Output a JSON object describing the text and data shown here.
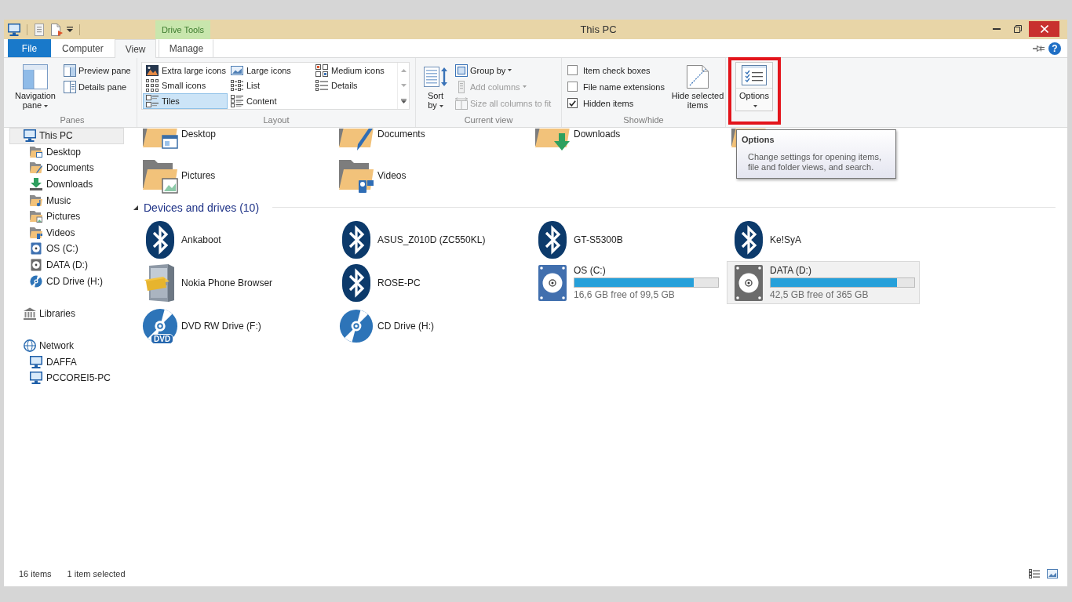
{
  "window": {
    "title": "This PC",
    "context_header": "Drive Tools"
  },
  "tabs": [
    {
      "label": "File",
      "kind": "file",
      "selected": false
    },
    {
      "label": "Computer",
      "kind": "tab",
      "selected": false
    },
    {
      "label": "View",
      "kind": "tab",
      "selected": true
    },
    {
      "label": "Manage",
      "kind": "context",
      "selected": false
    }
  ],
  "help": "?",
  "ribbon": {
    "panes": {
      "label": "Panes",
      "navigation_pane": {
        "label": "Navigation pane",
        "dropdown": true
      },
      "buttons": [
        {
          "label": "Preview pane"
        },
        {
          "label": "Details pane"
        }
      ]
    },
    "layout": {
      "label": "Layout",
      "options": [
        {
          "label": "Extra large icons",
          "selected": false
        },
        {
          "label": "Large icons",
          "selected": false
        },
        {
          "label": "Medium icons",
          "selected": false
        },
        {
          "label": "Small icons",
          "selected": false
        },
        {
          "label": "List",
          "selected": false
        },
        {
          "label": "Details",
          "selected": false
        },
        {
          "label": "Tiles",
          "selected": true
        },
        {
          "label": "Content",
          "selected": false
        }
      ]
    },
    "current_view": {
      "label": "Current view",
      "sort_by": {
        "label": "Sort by",
        "dropdown": true
      },
      "buttons": [
        {
          "label": "Group by",
          "dropdown": true,
          "disabled": false
        },
        {
          "label": "Add columns",
          "dropdown": true,
          "disabled": true
        },
        {
          "label": "Size all columns to fit",
          "dropdown": false,
          "disabled": true
        }
      ]
    },
    "show_hide": {
      "label": "Show/hide",
      "checkboxes": [
        {
          "label": "Item check boxes",
          "checked": false
        },
        {
          "label": "File name extensions",
          "checked": false
        },
        {
          "label": "Hidden items",
          "checked": true
        }
      ],
      "hide_selected": {
        "label": "Hide selected items"
      }
    },
    "options": {
      "label": "Options",
      "dropdown": true,
      "hovered": true,
      "highlighted": true
    }
  },
  "tooltip": {
    "title": "Options",
    "text": "Change settings for opening items, file and folder views, and search."
  },
  "sidebar": {
    "items": [
      {
        "label": "This PC",
        "kind": "pc",
        "selected": true,
        "children": [
          {
            "label": "Desktop",
            "kind": "desktop",
            "selected": false
          },
          {
            "label": "Documents",
            "kind": "documents",
            "selected": false
          },
          {
            "label": "Downloads",
            "kind": "downloads",
            "selected": false
          },
          {
            "label": "Music",
            "kind": "music",
            "selected": false
          },
          {
            "label": "Pictures",
            "kind": "pictures",
            "selected": false
          },
          {
            "label": "Videos",
            "kind": "videos",
            "selected": false
          },
          {
            "label": "OS (C:)",
            "kind": "system-disk",
            "selected": false
          },
          {
            "label": "DATA (D:)",
            "kind": "disk",
            "selected": false
          },
          {
            "label": "CD Drive (H:)",
            "kind": "cd",
            "selected": false
          }
        ]
      },
      {
        "label": "Libraries",
        "kind": "libraries",
        "selected": false
      },
      {
        "label": "Network",
        "kind": "network",
        "selected": false,
        "children": [
          {
            "label": "DAFFA",
            "kind": "computer",
            "selected": false
          },
          {
            "label": "PCCOREI5-PC",
            "kind": "computer",
            "selected": false
          }
        ]
      }
    ]
  },
  "folders": [
    {
      "name": "Desktop",
      "kind": "desktop",
      "selected": false
    },
    {
      "name": "Documents",
      "kind": "documents",
      "selected": false
    },
    {
      "name": "Downloads",
      "kind": "downloads",
      "selected": false
    },
    {
      "kind": "folder"
    },
    {
      "name": "Pictures",
      "kind": "pictures",
      "selected": false
    },
    {
      "name": "Videos",
      "kind": "videos",
      "selected": false
    }
  ],
  "devices": {
    "title": "Devices and drives (10)",
    "expanded": true,
    "items": [
      {
        "name": "Ankaboot",
        "kind": "bluetooth",
        "selected": false
      },
      {
        "name": "ASUS_Z010D (ZC550KL)",
        "kind": "bluetooth",
        "selected": false
      },
      {
        "name": "GT-S5300B",
        "kind": "bluetooth",
        "selected": false
      },
      {
        "name": "Ke!SyA",
        "kind": "bluetooth",
        "selected": false
      },
      {
        "name": "Nokia Phone Browser",
        "kind": "phone-browser",
        "selected": false
      },
      {
        "name": "ROSE-PC",
        "kind": "bluetooth",
        "selected": false
      },
      {
        "name": "OS (C:)",
        "kind": "system-disk",
        "level": 0.83,
        "free": "16,6 GB free of 99,5 GB",
        "selected": false
      },
      {
        "name": "DATA (D:)",
        "kind": "disk",
        "level": 0.88,
        "free": "42,5 GB free of 365 GB",
        "selected": true
      },
      {
        "name": "DVD RW Drive (F:)",
        "kind": "dvd",
        "badge": "DVD",
        "selected": false
      },
      {
        "name": "CD Drive (H:)",
        "kind": "cd",
        "selected": false
      }
    ]
  },
  "status_bar": {
    "item_count": "16 items",
    "selection": "1 item selected"
  }
}
